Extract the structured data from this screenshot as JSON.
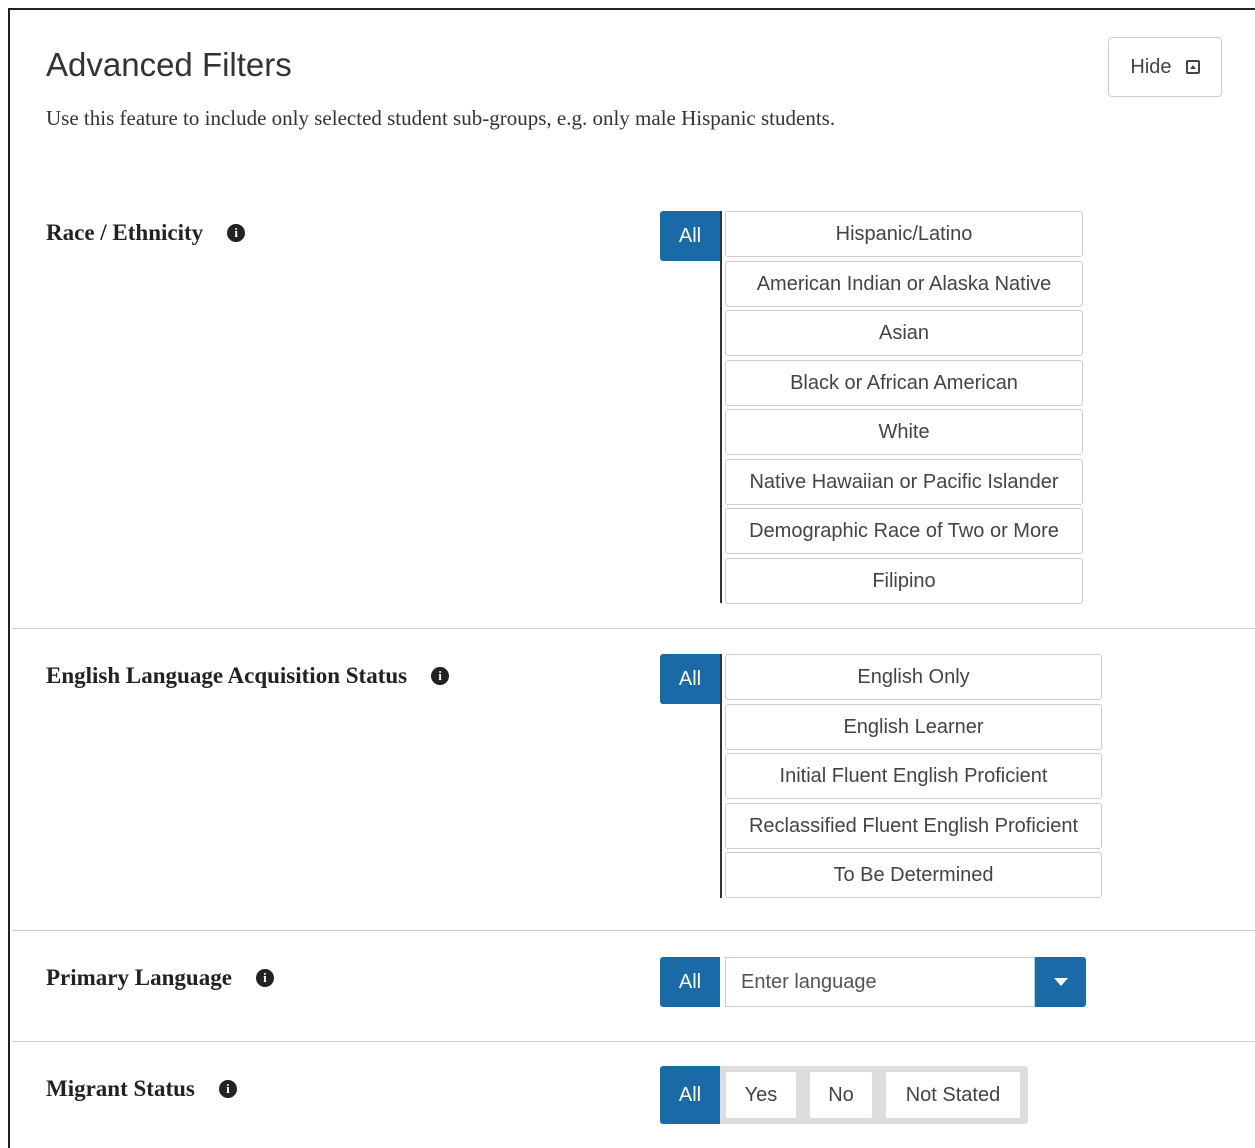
{
  "header": {
    "title": "Advanced Filters",
    "subtitle": "Use this feature to include only selected student sub-groups, e.g. only male Hispanic students.",
    "hide_label": "Hide"
  },
  "colors": {
    "accent": "#1a6aa8",
    "divider": "#d0d0d0"
  },
  "race": {
    "label": "Race / Ethnicity",
    "all_label": "All",
    "options": [
      "Hispanic/Latino",
      "American Indian or Alaska Native",
      "Asian",
      "Black or African American",
      "White",
      "Native Hawaiian or Pacific Islander",
      "Demographic Race of Two or More",
      "Filipino"
    ]
  },
  "ela": {
    "label": "English Language Acquisition Status",
    "all_label": "All",
    "options": [
      "English Only",
      "English Learner",
      "Initial Fluent English Proficient",
      "Reclassified Fluent English Proficient",
      "To Be Determined"
    ]
  },
  "primary_language": {
    "label": "Primary Language",
    "all_label": "All",
    "placeholder": "Enter language"
  },
  "migrant": {
    "label": "Migrant Status",
    "all_label": "All",
    "options": [
      "Yes",
      "No",
      "Not Stated"
    ]
  }
}
